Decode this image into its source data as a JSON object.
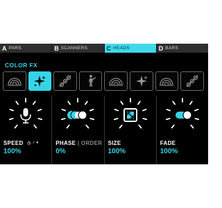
{
  "tabs": [
    {
      "letter": "A",
      "label": "PARS"
    },
    {
      "letter": "B",
      "label": "SCANNERS"
    },
    {
      "letter": "C",
      "label": "HEADS",
      "active": true
    },
    {
      "letter": "D",
      "label": "BARS"
    }
  ],
  "section_title": "COLOR FX",
  "fx_buttons": [
    {
      "icon": "rainbow-arc-icon",
      "active": false
    },
    {
      "icon": "sparkle-icon",
      "active": true
    },
    {
      "icon": "chain-dots-icon",
      "active": false
    },
    {
      "icon": "performer-icon",
      "active": false
    },
    {
      "icon": "rainbow-arc-icon",
      "active": false
    },
    {
      "icon": "sparkle-icon",
      "active": false
    },
    {
      "icon": "rainbow-arc-icon",
      "active": false
    },
    {
      "icon": "chain-dots-icon",
      "active": false
    }
  ],
  "params": {
    "speed": {
      "label": "SPEED",
      "value": "100%",
      "icon": "microphone-icon"
    },
    "phase": {
      "label": "PHASE",
      "separator": "|",
      "label2": "ORDER",
      "value": "0%",
      "icon": "phase-toggle-icon"
    },
    "size": {
      "label": "SIZE",
      "value": "100%",
      "icon": "resize-icon"
    },
    "fade": {
      "label": "FADE",
      "value": "100%",
      "icon": "fade-toggle-icon"
    }
  },
  "colors": {
    "accent": "#36d4e6",
    "background": "#000000"
  }
}
